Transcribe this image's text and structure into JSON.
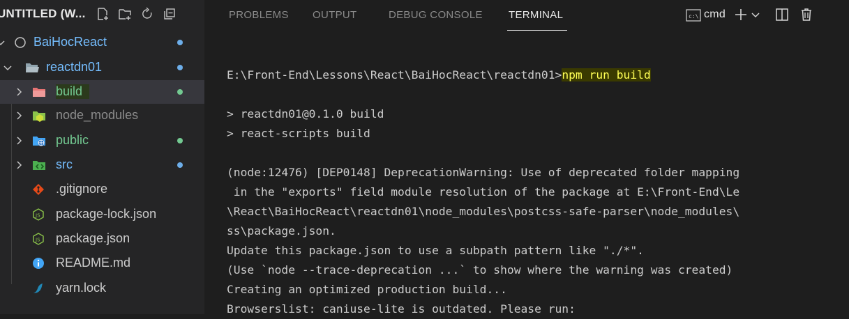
{
  "explorer": {
    "title": "UNTITLED (W...",
    "items": [
      {
        "label": "BaiHocReact",
        "color": "#75beff",
        "modified": true
      },
      {
        "label": "reactdn01",
        "color": "#75beff",
        "modified": true
      },
      {
        "label": "build",
        "color": "#73c991",
        "modified": true
      },
      {
        "label": "node_modules",
        "color": "#8c8c8c",
        "modified": false
      },
      {
        "label": "public",
        "color": "#73c991",
        "modified": true
      },
      {
        "label": "src",
        "color": "#75beff",
        "modified": true
      },
      {
        "label": ".gitignore",
        "color": "#cccccc",
        "modified": false
      },
      {
        "label": "package-lock.json",
        "color": "#cccccc",
        "modified": false
      },
      {
        "label": "package.json",
        "color": "#cccccc",
        "modified": false
      },
      {
        "label": "README.md",
        "color": "#cccccc",
        "modified": false
      },
      {
        "label": "yarn.lock",
        "color": "#cccccc",
        "modified": false
      }
    ]
  },
  "panel": {
    "tabs": [
      "PROBLEMS",
      "OUTPUT",
      "DEBUG CONSOLE",
      "TERMINAL"
    ],
    "active_tab": "TERMINAL",
    "terminal_profile": "cmd"
  },
  "terminal": {
    "prompt": "E:\\Front-End\\Lessons\\React\\BaiHocReact\\reactdn01>",
    "command": "npm run build",
    "lines": [
      "",
      "> reactdn01@0.1.0 build",
      "> react-scripts build",
      "",
      "(node:12476) [DEP0148] DeprecationWarning: Use of deprecated folder mapping",
      " in the \"exports\" field module resolution of the package at E:\\Front-End\\Le",
      "\\React\\BaiHocReact\\reactdn01\\node_modules\\postcss-safe-parser\\node_modules\\",
      "ss\\package.json.",
      "Update this package.json to use a subpath pattern like \"./*\".",
      "(Use `node --trace-deprecation ...` to show where the warning was created)",
      "Creating an optimized production build...",
      "Browserslist: caniuse-lite is outdated. Please run:"
    ]
  }
}
